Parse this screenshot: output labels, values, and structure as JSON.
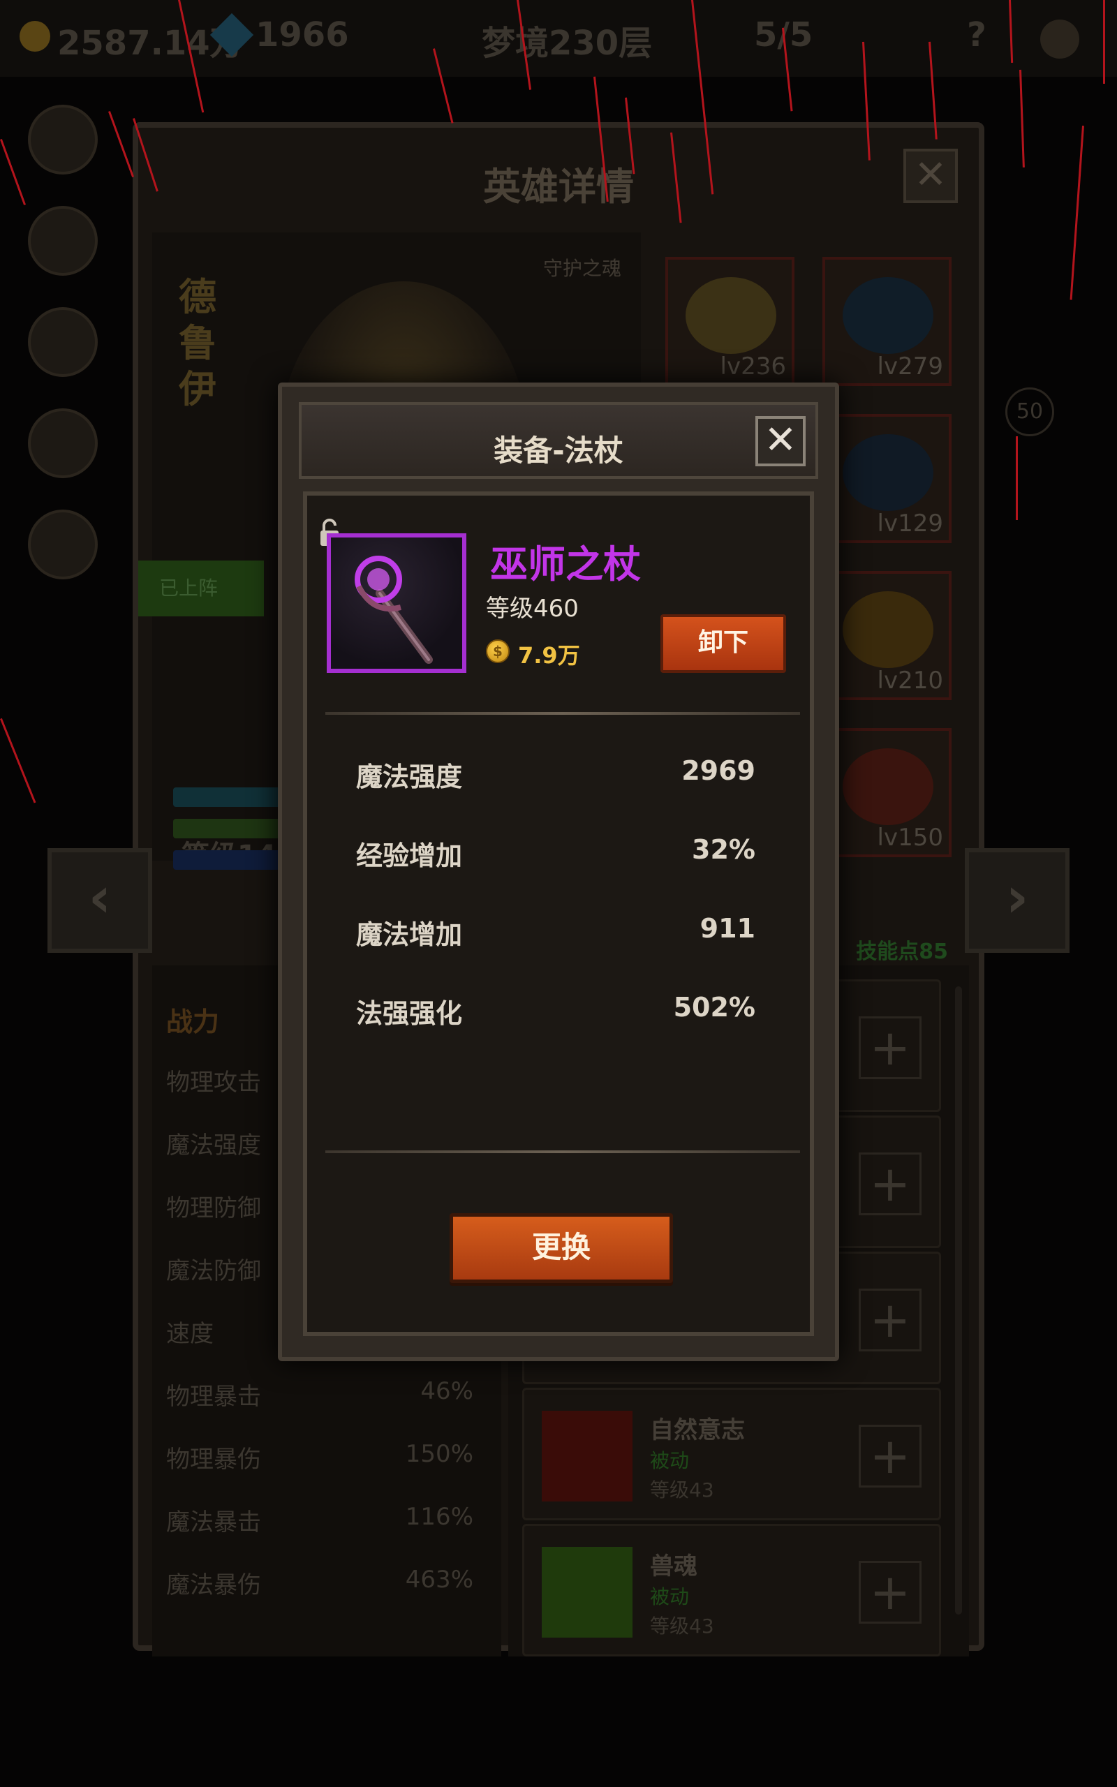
{
  "topbar": {
    "gold": "2587.14万",
    "gems": "1966",
    "floor": "梦境230层",
    "skull_count": "5/5",
    "help": "?"
  },
  "hero_panel": {
    "title": "英雄详情",
    "close_glyph": "✕",
    "hero_name": "德鲁伊",
    "guard_label": "守护之魂",
    "deployed_label": "已上阵",
    "hero_level": "等级145",
    "power_label": "战力",
    "side_badge": "50",
    "prev_glyph": "‹",
    "next_glyph": "›"
  },
  "equipment_slots": [
    {
      "level": "lv236"
    },
    {
      "level": "lv279"
    },
    {
      "level": "lv129"
    },
    {
      "level": "lv210"
    },
    {
      "level": "lv150"
    }
  ],
  "stats": [
    {
      "label": "物理攻击",
      "value": ""
    },
    {
      "label": "魔法强度",
      "value": ""
    },
    {
      "label": "物理防御",
      "value": ""
    },
    {
      "label": "魔法防御",
      "value": ""
    },
    {
      "label": "速度",
      "value": ""
    },
    {
      "label": "物理暴击",
      "value": "46%"
    },
    {
      "label": "物理暴伤",
      "value": "150%"
    },
    {
      "label": "魔法暴击",
      "value": "116%"
    },
    {
      "label": "魔法暴伤",
      "value": "463%"
    }
  ],
  "skills": {
    "points": "技能点85",
    "items": [
      {
        "name": "",
        "type": "",
        "level": ""
      },
      {
        "name": "",
        "type": "",
        "level": ""
      },
      {
        "name": "",
        "type": "",
        "level": ""
      },
      {
        "name": "自然意志",
        "type": "被动",
        "level": "等级43"
      },
      {
        "name": "兽魂",
        "type": "被动",
        "level": "等级43"
      }
    ],
    "plus_glyph": "+"
  },
  "modal": {
    "title": "装备-法杖",
    "close_glyph": "✕",
    "item_name": "巫师之杖",
    "item_level": "等级460",
    "coin_glyph": "$",
    "price": "7.9万",
    "unequip_label": "卸下",
    "attributes": [
      {
        "label": "魔法强度",
        "value": "2969"
      },
      {
        "label": "经验增加",
        "value": "32%"
      },
      {
        "label": "魔法增加",
        "value": "911"
      },
      {
        "label": "法强强化",
        "value": "502%"
      }
    ],
    "replace_label": "更换",
    "item_frame_color": "#a52fd1",
    "item_name_color": "#c235e8",
    "button_color": "#c4471a"
  }
}
